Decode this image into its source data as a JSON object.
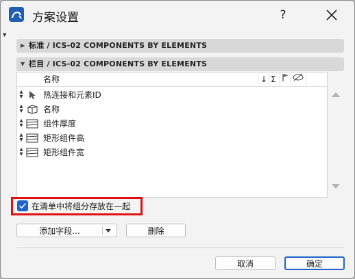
{
  "window": {
    "title": "方案设置",
    "help": "?"
  },
  "sections": [
    {
      "label": "标准 / ICS-02 COMPONENTS BY ELEMENTS",
      "expanded": false
    },
    {
      "label": "栏目 / ICS-02 COMPONENTS BY ELEMENTS",
      "expanded": true
    }
  ],
  "list": {
    "header": {
      "name": "名称",
      "sort": "↓",
      "sum": "Σ"
    },
    "rows": [
      {
        "label": "热连接和元素ID",
        "icon": "cursor-icon"
      },
      {
        "label": "名称",
        "icon": "3d-box-icon"
      },
      {
        "label": "组件厚度",
        "icon": "hatch-icon"
      },
      {
        "label": "矩形组件高",
        "icon": "hatch-icon"
      },
      {
        "label": "矩形组件宽",
        "icon": "hatch-icon"
      }
    ]
  },
  "group_option": {
    "label": "在清单中将组分存放在一起",
    "checked": true
  },
  "buttons": {
    "add_field": "添加字段...",
    "delete": "删除",
    "cancel": "取消",
    "ok": "确定"
  },
  "colors": {
    "accent": "#1e64c8",
    "highlight": "#e01010"
  }
}
